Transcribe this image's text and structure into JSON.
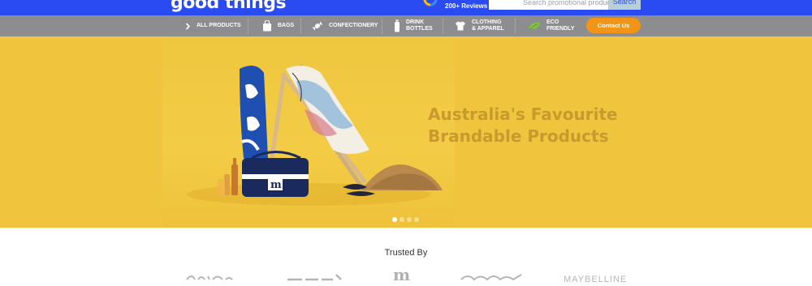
{
  "header": {
    "logo_text": "good things",
    "reviews_label": "200+ Reviews",
    "google_icon": "google-g-icon",
    "search": {
      "placeholder": "Search promotional products",
      "button_label": "Search"
    }
  },
  "nav": {
    "items": [
      {
        "label_line1": "All Products",
        "label_line2": "",
        "icon": "chevron-right-icon"
      },
      {
        "label_line1": "Bags",
        "label_line2": "",
        "icon": "bag-icon"
      },
      {
        "label_line1": "Confectionery",
        "label_line2": "",
        "icon": "candy-icon"
      },
      {
        "label_line1": "Drink",
        "label_line2": "Bottles",
        "icon": "bottle-icon"
      },
      {
        "label_line1": "Clothing",
        "label_line2": "& Apparel",
        "icon": "tshirt-icon"
      },
      {
        "label_line1": "Eco",
        "label_line2": "Friendly",
        "icon": "leaf-icon"
      }
    ],
    "contact_label": "Contact Us"
  },
  "hero": {
    "headline_line1": "Australia's Favourite",
    "headline_line2": "Brandable Products",
    "slides_count": 4,
    "active_slide": 1
  },
  "trusted": {
    "title": "Trusted By",
    "brands": [
      "brand-logo-1",
      "brand-logo-2",
      "brand-logo-3",
      "brand-logo-4",
      "brand-logo-5"
    ],
    "maybelline_text": "MAYBELLINE"
  },
  "colors": {
    "header_blue": "#2b4bf2",
    "nav_grey": "#8d8d90",
    "accent_orange": "#f29418",
    "hero_yellow": "#f0c43c",
    "headline_gold": "#c89a2e"
  }
}
